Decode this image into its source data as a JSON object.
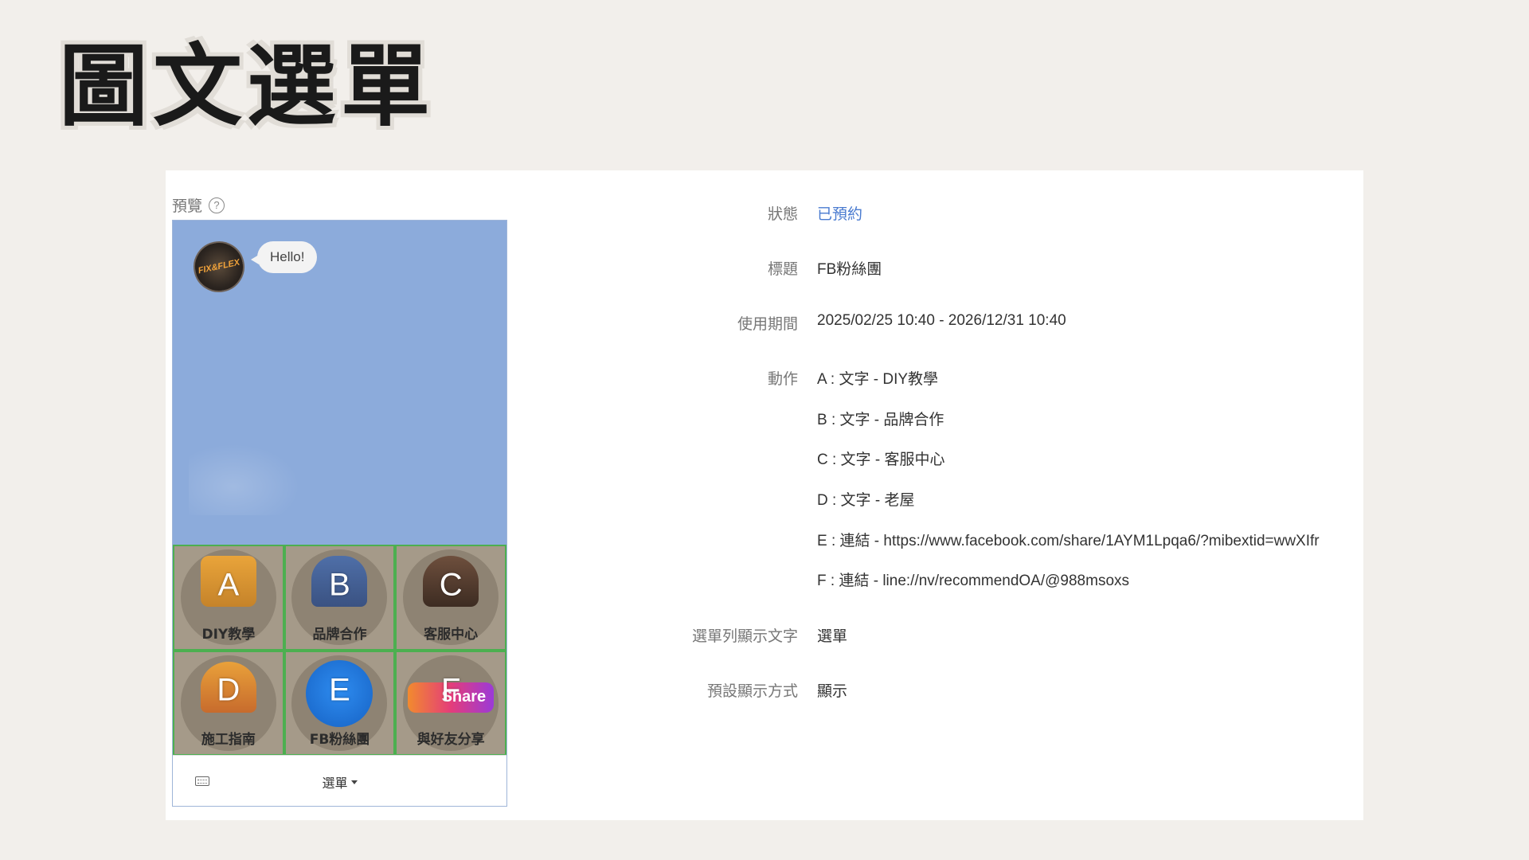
{
  "slide": {
    "title": "圖文選單"
  },
  "preview": {
    "label": "預覽",
    "help_icon": "?",
    "avatar_text": "FIX&FLEX",
    "greeting": "Hello!",
    "cells": [
      {
        "letter": "A",
        "caption": "DIY教學",
        "icon": "tools-icon"
      },
      {
        "letter": "B",
        "caption": "品牌合作",
        "icon": "handshake-icon"
      },
      {
        "letter": "C",
        "caption": "客服中心",
        "icon": "support-agent-icon"
      },
      {
        "letter": "D",
        "caption": "施工指南",
        "icon": "construction-worker-icon"
      },
      {
        "letter": "E",
        "caption": "FB粉絲團",
        "icon": "thumbs-up-icon"
      },
      {
        "letter": "F",
        "caption": "與好友分享",
        "icon": "share-icon",
        "art_text": "Share"
      }
    ],
    "bottom_bar": {
      "menu_label": "選單"
    }
  },
  "details": {
    "status": {
      "label": "狀態",
      "value": "已預約"
    },
    "title": {
      "label": "標題",
      "value": "FB粉絲團"
    },
    "period": {
      "label": "使用期間",
      "value": "2025/02/25 10:40 - 2026/12/31 10:40"
    },
    "actions": {
      "label": "動作",
      "items": [
        "A : 文字 - DIY教學",
        "B : 文字 - 品牌合作",
        "C : 文字 - 客服中心",
        "D : 文字 - 老屋",
        "E : 連結 - https://www.facebook.com/share/1AYM1Lpqa6/?mibextid=wwXIfr",
        "F : 連結 - line://nv/recommendOA/@988msoxs"
      ]
    },
    "menu_bar_text": {
      "label": "選單列顯示文字",
      "value": "選單"
    },
    "default_display": {
      "label": "預設顯示方式",
      "value": "顯示"
    }
  },
  "colors": {
    "background": "#f2efeb",
    "chat_bg": "#8cabdb",
    "grid_border": "#4caf50",
    "link": "#4a7bd0"
  }
}
